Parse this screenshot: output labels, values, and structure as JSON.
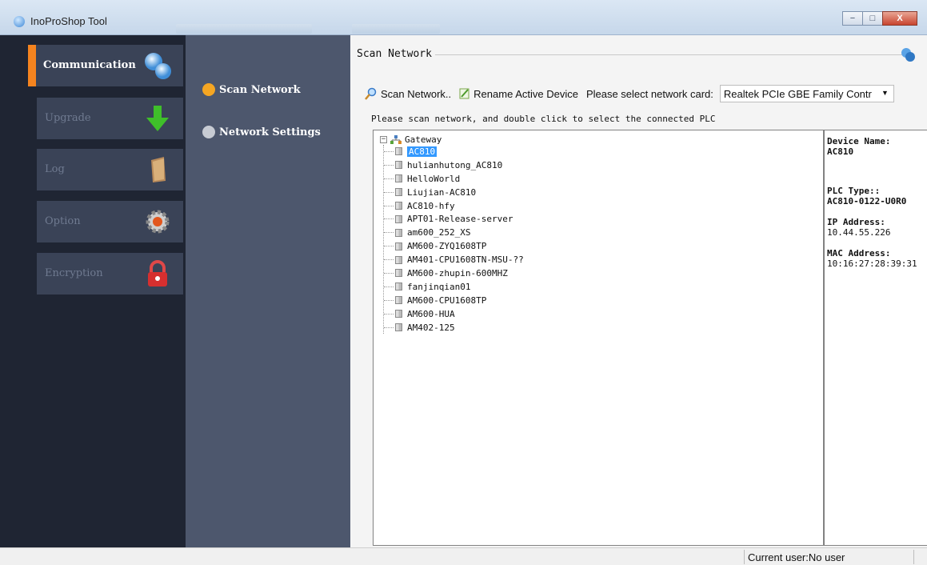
{
  "window": {
    "title": "InoProShop Tool",
    "buttons": {
      "minimize": "−",
      "maximize": "□",
      "close": "X"
    }
  },
  "nav": {
    "items": [
      {
        "label": "Communication",
        "icon": "communication-icon",
        "active": true
      },
      {
        "label": "Upgrade",
        "icon": "download-arrow-icon",
        "active": false
      },
      {
        "label": "Log",
        "icon": "book-icon",
        "active": false
      },
      {
        "label": "Option",
        "icon": "gear-icon",
        "active": false
      },
      {
        "label": "Encryption",
        "icon": "lock-icon",
        "active": false
      }
    ]
  },
  "submenu": {
    "items": [
      {
        "label": "Scan Network",
        "dot_color": "#f5a623",
        "active": true
      },
      {
        "label": "Network Settings",
        "dot_color": "#c7cbd3",
        "active": false
      }
    ]
  },
  "scan": {
    "group_title": "Scan Network",
    "scan_button": "Scan Network..",
    "rename_button": "Rename Active Device",
    "network_card_label": "Please select network card:",
    "network_card_value": "Realtek PCIe GBE Family Contr",
    "hint": "Please scan network, and double click to select the connected PLC",
    "tree": {
      "root": "Gateway",
      "nodes": [
        {
          "label": "AC810",
          "selected": true
        },
        {
          "label": "hulianhutong_AC810",
          "selected": false
        },
        {
          "label": "HelloWorld",
          "selected": false
        },
        {
          "label": "Liujian-AC810",
          "selected": false
        },
        {
          "label": "AC810-hfy",
          "selected": false
        },
        {
          "label": "APT01-Release-server",
          "selected": false
        },
        {
          "label": "am600_252_XS",
          "selected": false
        },
        {
          "label": "AM600-ZYQ1608TP",
          "selected": false
        },
        {
          "label": "AM401-CPU1608TN-MSU-??",
          "selected": false
        },
        {
          "label": "AM600-zhupin-600MHZ",
          "selected": false
        },
        {
          "label": "fanjinqian01",
          "selected": false
        },
        {
          "label": "AM600-CPU1608TP",
          "selected": false
        },
        {
          "label": "AM600-HUA",
          "selected": false
        },
        {
          "label": "AM402-125",
          "selected": false
        }
      ]
    },
    "device_info": {
      "device_name_label": "Device Name:",
      "device_name": "AC810",
      "plc_type_label": "PLC Type::",
      "plc_type": "AC810-0122-U0R0",
      "ip_label": "IP Address:",
      "ip": "10.44.55.226",
      "mac_label": "MAC Address:",
      "mac": "10:16:27:28:39:31"
    }
  },
  "status": {
    "current_user": "Current user:No user"
  },
  "colors": {
    "accent": "#f5841f",
    "nav_bg": "#1f2533",
    "submenu_bg": "#4d576d",
    "selection": "#3399ff"
  }
}
